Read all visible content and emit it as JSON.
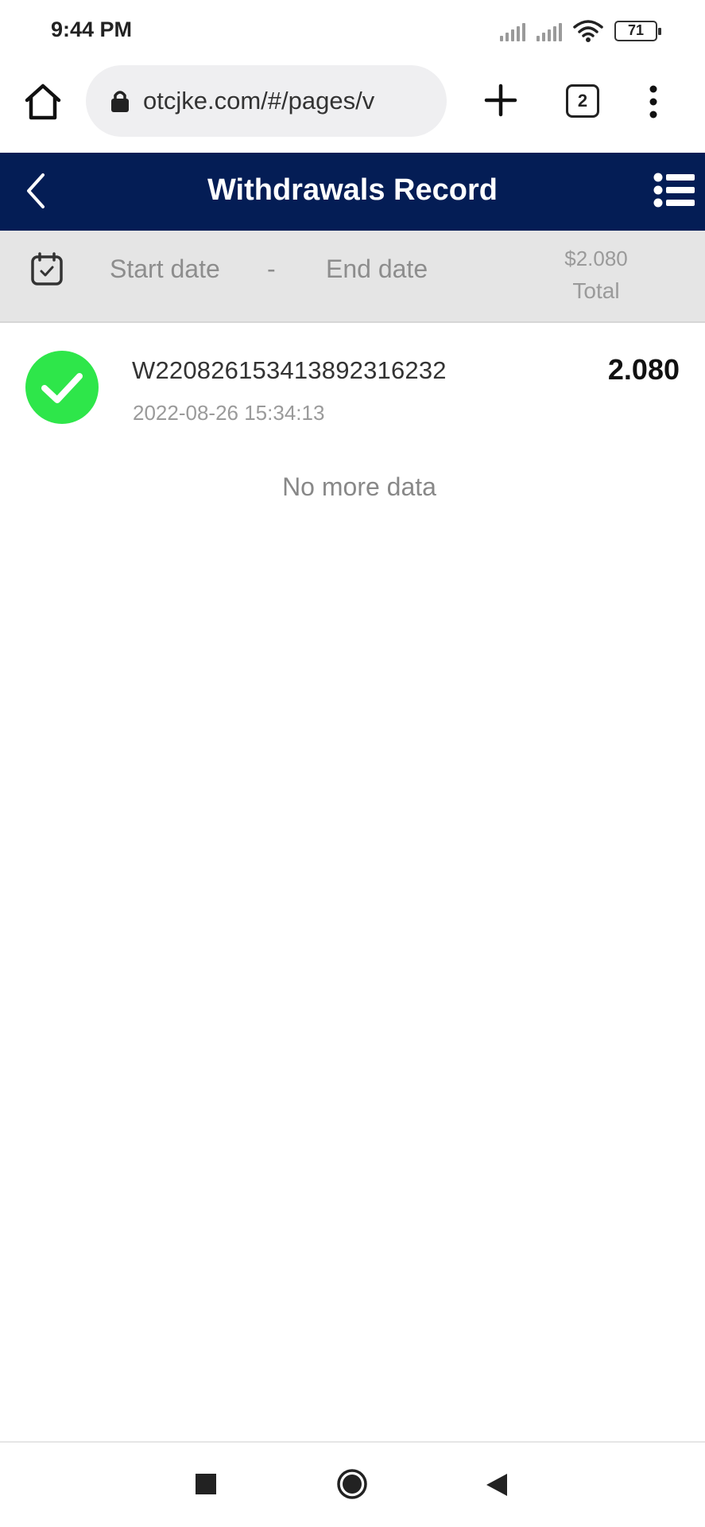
{
  "status_bar": {
    "time": "9:44 PM",
    "battery": "71"
  },
  "browser": {
    "url": "otcjke.com/#/pages/v",
    "tab_count": "2"
  },
  "header": {
    "title": "Withdrawals Record"
  },
  "filter": {
    "start_date_placeholder": "Start date",
    "separator": "-",
    "end_date_placeholder": "End date",
    "total_amount": "$2.080",
    "total_label": "Total"
  },
  "records": [
    {
      "id": "W220826153413892316232",
      "time": "2022-08-26 15:34:13",
      "amount": "2.080",
      "status": "success"
    }
  ],
  "list_footer": "No more data",
  "colors": {
    "header_bg": "#041d55",
    "success_green": "#2ee64a",
    "filter_bg": "#e5e5e5"
  },
  "icons": [
    "home-icon",
    "lock-icon",
    "plus-icon",
    "tabs-icon",
    "more-vert-icon",
    "back-chevron-icon",
    "list-menu-icon",
    "calendar-icon",
    "check-circle-icon",
    "nav-recent-icon",
    "nav-home-icon",
    "nav-back-icon"
  ]
}
